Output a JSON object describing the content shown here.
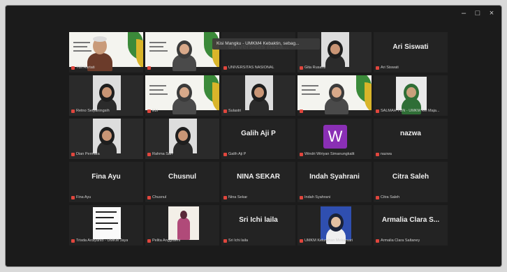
{
  "window": {
    "controls": {
      "minimize": "–",
      "maximize": "□",
      "close": "×"
    }
  },
  "tooltip": "Kisi Mangku - UMKM4 Kebaktin, sebag...",
  "tiles": [
    {
      "id": "t1",
      "display": "",
      "label": "Yuli Hartati",
      "video": "slide-person-man"
    },
    {
      "id": "t2",
      "display": "",
      "label": "",
      "video": "slide-person-hijab"
    },
    {
      "id": "t3",
      "display": "universitas nasa...",
      "label": "UNIVERSITAS NASIONAL",
      "video": "name"
    },
    {
      "id": "t4",
      "display": "",
      "label": "Gita Rusanti",
      "video": "person-hijab-small"
    },
    {
      "id": "t5",
      "display": "Ari Siswati",
      "label": "Ari Siswati",
      "video": "name"
    },
    {
      "id": "t6",
      "display": "",
      "label": "Retno Setyaningsih",
      "video": "person-hijab-small"
    },
    {
      "id": "t7",
      "display": "",
      "label": "Ebi",
      "video": "slide-person-hijab"
    },
    {
      "id": "t8",
      "display": "",
      "label": "Sulastri",
      "video": "person-hijab-small"
    },
    {
      "id": "t9",
      "display": "",
      "label": "",
      "video": "slide-person-hijab"
    },
    {
      "id": "t10",
      "display": "",
      "label": "SALMAH TUN - UMKM Kel Maja...",
      "video": "person-hijab-green"
    },
    {
      "id": "t11",
      "display": "",
      "label": "Dian Permata",
      "video": "person-hijab-small"
    },
    {
      "id": "t12",
      "display": "",
      "label": "Rahma Sari",
      "video": "person-hijab-small"
    },
    {
      "id": "t13",
      "display": "Galih Aji P",
      "label": "Galih Aji P",
      "video": "name"
    },
    {
      "id": "t14",
      "display": "",
      "label": "Windri Wiriyan Simanungkalit",
      "video": "avatar-w",
      "avatar": "W"
    },
    {
      "id": "t15",
      "display": "nazwa",
      "label": "nazwa",
      "video": "name"
    },
    {
      "id": "t16",
      "display": "Fina Ayu",
      "label": "Fina Ayu",
      "video": "name"
    },
    {
      "id": "t17",
      "display": "Chusnul",
      "label": "Chusnul",
      "video": "name"
    },
    {
      "id": "t18",
      "display": "NINA SEKAR",
      "label": "Nina Sekar",
      "video": "name"
    },
    {
      "id": "t19",
      "display": "Indah Syahrani",
      "label": "Indah Syahrani",
      "video": "name"
    },
    {
      "id": "t20",
      "display": "Citra Saleh",
      "label": "Citra Saleh",
      "video": "name"
    },
    {
      "id": "t21",
      "display": "",
      "label": "Trisda Ardiyanto - UMKM Jaya",
      "video": "document"
    },
    {
      "id": "t22",
      "display": "",
      "label": "Pelita Anggraeni",
      "video": "person-pink"
    },
    {
      "id": "t23",
      "display": "Sri Ichi laila",
      "label": "Sri Ichi laila",
      "video": "name"
    },
    {
      "id": "t24",
      "display": "",
      "label": "UMKM Kelurahan Mekarsari",
      "video": "person-hijab-blue"
    },
    {
      "id": "t25",
      "display": "Armalia Clara S...",
      "label": "Armalia Clara Saltaney",
      "video": "name"
    }
  ],
  "colors": {
    "window_bg": "#1b1b1b",
    "tile_bg": "#232323",
    "mic_muted": "#e0463d",
    "avatar_bg": "#8a2fb5"
  }
}
